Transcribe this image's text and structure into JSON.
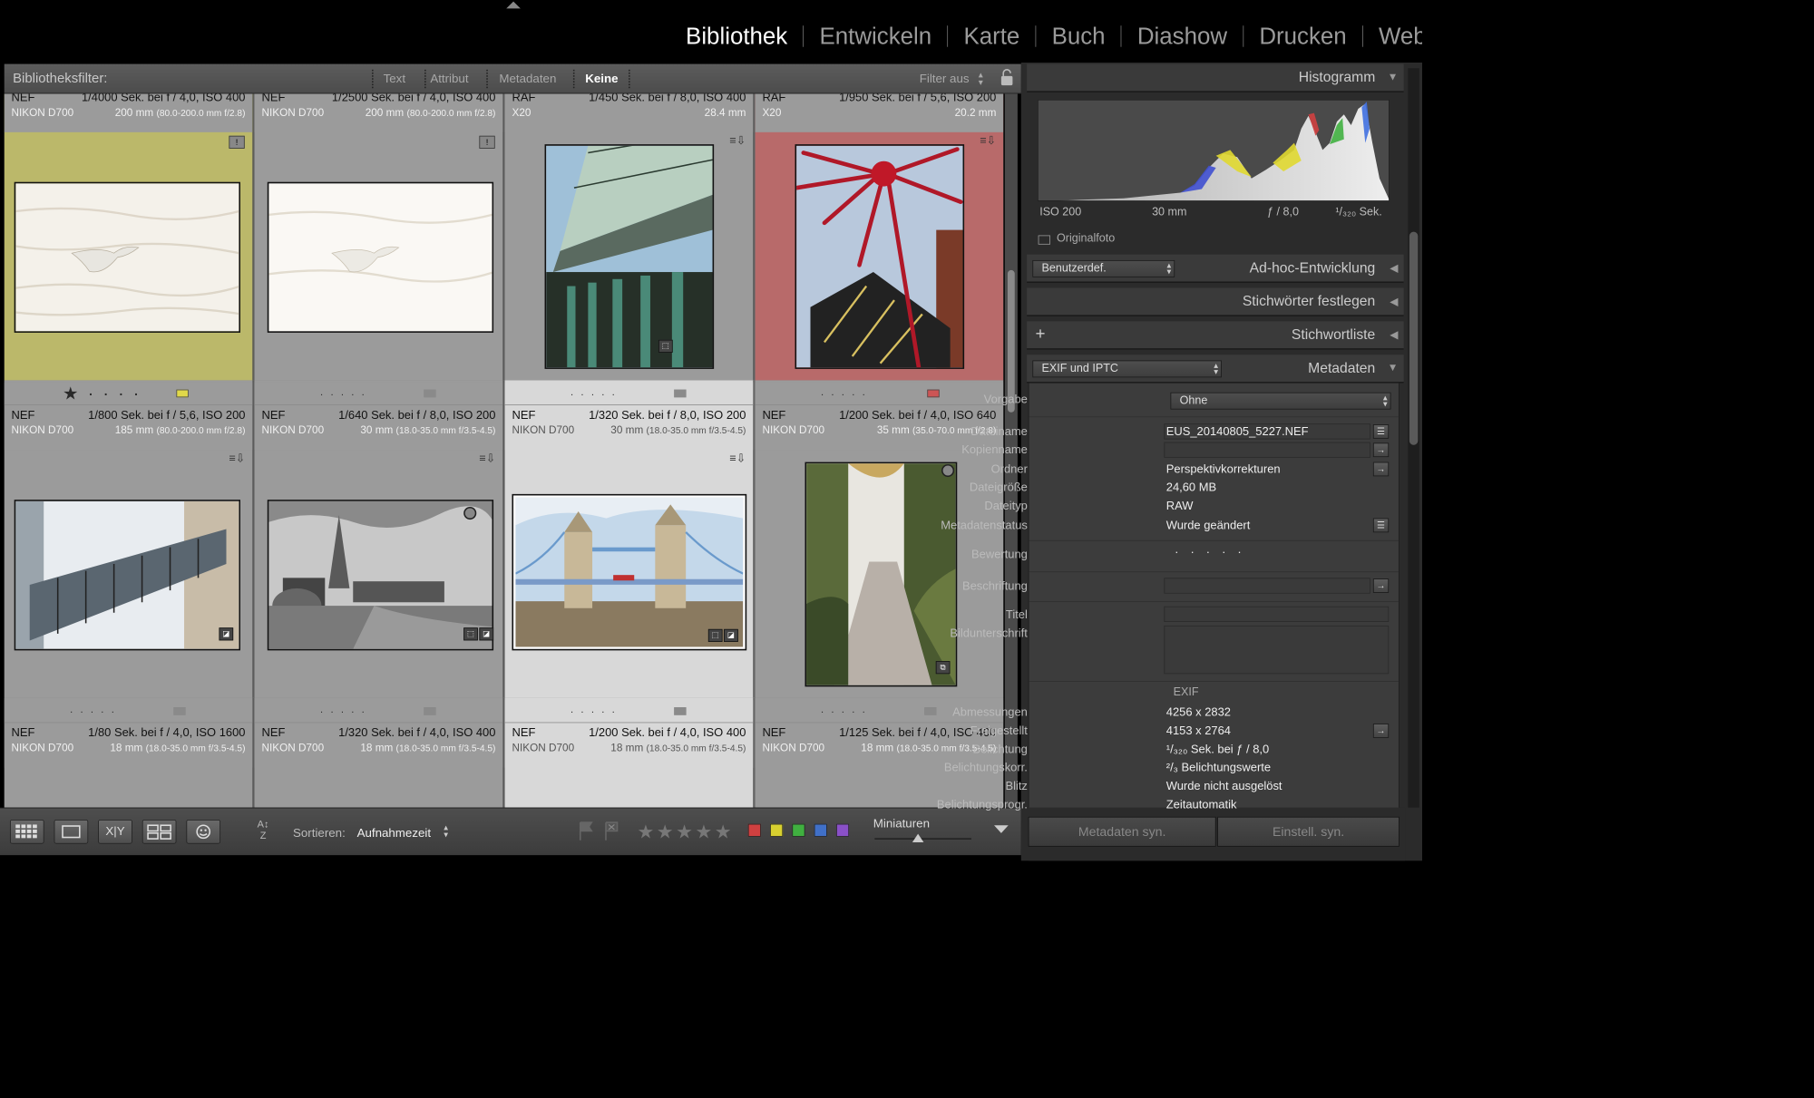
{
  "modules": [
    "Bibliothek",
    "Entwickeln",
    "Karte",
    "Buch",
    "Diashow",
    "Drucken",
    "Web"
  ],
  "filterbar": {
    "label": "Bibliotheksfilter:",
    "tabs": [
      "Text",
      "Attribut",
      "Metadaten",
      "Keine"
    ],
    "active_tab": "Keine",
    "filter_status": "Filter aus"
  },
  "grid": {
    "cells": [
      {
        "stars": "★★★★★",
        "chip": "#8a8a8a",
        "fmt": "NEF",
        "exposure": "1/4000 Sek. bei f / 4,0, ISO 400",
        "camera": "NIKON D700",
        "lens": "200 mm",
        "lens_extra": "(80.0-200.0 mm f/2.8)",
        "bg": "yellow"
      },
      {
        "stars": "★★ · · ·",
        "chip": "#cc5555",
        "fmt": "NEF",
        "exposure": "1/2500 Sek. bei f / 4,0, ISO 400",
        "camera": "NIKON D700",
        "lens": "200 mm",
        "lens_extra": "(80.0-200.0 mm f/2.8)",
        "bg": "none"
      },
      {
        "stars": "· · · · ·",
        "chip": "#cc5555",
        "fmt": "RAF",
        "exposure": "1/450 Sek. bei f / 8,0, ISO 400",
        "camera": "X20",
        "lens": "28.4 mm",
        "lens_extra": "",
        "bg": "none"
      },
      {
        "stars": "· · · · ·",
        "chip": "#cc5555",
        "fmt": "RAF",
        "exposure": "1/950 Sek. bei f / 5,6, ISO 200",
        "camera": "X20",
        "lens": "20.2 mm",
        "lens_extra": "",
        "bg": "red"
      },
      {
        "stars": "★ · · · ·",
        "chip": "#e0d84a",
        "fmt": "NEF",
        "exposure": "1/800 Sek. bei f / 5,6, ISO 200",
        "camera": "NIKON D700",
        "lens": "185 mm",
        "lens_extra": "(80.0-200.0 mm f/2.8)",
        "bg": "none"
      },
      {
        "stars": "· · · · ·",
        "chip": "#8a8a8a",
        "fmt": "NEF",
        "exposure": "1/640 Sek. bei f / 8,0, ISO 200",
        "camera": "NIKON D700",
        "lens": "30 mm",
        "lens_extra": "(18.0-35.0 mm f/3.5-4.5)",
        "bg": "none"
      },
      {
        "stars": "· · · · ·",
        "chip": "#8a8a8a",
        "fmt": "NEF",
        "exposure": "1/320 Sek. bei f / 8,0, ISO 200",
        "camera": "NIKON D700",
        "lens": "30 mm",
        "lens_extra": "(18.0-35.0 mm f/3.5-4.5)",
        "bg": "selected"
      },
      {
        "stars": "· · · · ·",
        "chip": "#cc5555",
        "fmt": "NEF",
        "exposure": "1/200 Sek. bei f / 4,0, ISO 640",
        "camera": "NIKON D700",
        "lens": "35 mm",
        "lens_extra": "(35.0-70.0 mm f/2.8)",
        "bg": "none"
      },
      {
        "stars": "· · · · ·",
        "chip": "#8a8a8a",
        "fmt": "NEF",
        "exposure": "1/80 Sek. bei f / 4,0, ISO 1600",
        "camera": "NIKON D700",
        "lens": "18 mm",
        "lens_extra": "(18.0-35.0 mm f/3.5-4.5)",
        "bg": "none"
      },
      {
        "stars": "· · · · ·",
        "chip": "#8a8a8a",
        "fmt": "NEF",
        "exposure": "1/320 Sek. bei f / 4,0, ISO 400",
        "camera": "NIKON D700",
        "lens": "18 mm",
        "lens_extra": "(18.0-35.0 mm f/3.5-4.5)",
        "bg": "none"
      },
      {
        "stars": "· · · · ·",
        "chip": "#8a8a8a",
        "fmt": "NEF",
        "exposure": "1/200 Sek. bei f / 4,0, ISO 400",
        "camera": "NIKON D700",
        "lens": "18 mm",
        "lens_extra": "(18.0-35.0 mm f/3.5-4.5)",
        "bg": "selected"
      },
      {
        "stars": "· · · · ·",
        "chip": "#8a8a8a",
        "fmt": "NEF",
        "exposure": "1/125 Sek. bei f / 4,0, ISO 400",
        "camera": "NIKON D700",
        "lens": "18 mm",
        "lens_extra": "(18.0-35.0 mm f/3.5-4.5)",
        "bg": "none"
      }
    ]
  },
  "toolbar": {
    "sort_label": "Sortieren:",
    "sort_value": "Aufnahmezeit",
    "stars": "★★★★★",
    "color_labels": [
      "#d04040",
      "#d8d030",
      "#40b040",
      "#4070c8",
      "#8a50c8"
    ],
    "thumb_label": "Miniaturen",
    "thumb_size": 0.45
  },
  "right_panel": {
    "histogram": {
      "title": "Histogramm",
      "iso": "ISO 200",
      "focal": "30 mm",
      "aperture": "ƒ / 8,0",
      "shutter": "¹/₃₂₀ Sek.",
      "original_label": "Originalfoto"
    },
    "quick_develop": {
      "preset": "Benutzerdef.",
      "title": "Ad-hoc-Entwicklung"
    },
    "keywording": {
      "title": "Stichwörter festlegen"
    },
    "keyword_list": {
      "title": "Stichwortliste"
    },
    "metadata": {
      "view": "EXIF und IPTC",
      "title": "Metadaten",
      "preset_label": "Vorgabe",
      "preset_value": "Ohne",
      "rows": [
        {
          "label": "Dateiname",
          "value": "EUS_20140805_5227.NEF"
        },
        {
          "label": "Kopienname",
          "value": ""
        },
        {
          "label": "Ordner",
          "value": "Perspektivkorrekturen"
        },
        {
          "label": "Dateigröße",
          "value": "24,60 MB"
        },
        {
          "label": "Dateityp",
          "value": "RAW"
        },
        {
          "label": "Metadatenstatus",
          "value": "Wurde geändert"
        }
      ],
      "rating_label": "Bewertung",
      "rating_value": "· · · · ·",
      "caption_label": "Beschriftung",
      "title_label": "Titel",
      "description_label": "Bildunterschrift",
      "exif_header": "EXIF",
      "exif_rows": [
        {
          "label": "Abmessungen",
          "value": "4256 x 2832"
        },
        {
          "label": "Freigestellt",
          "value": "4153 x 2764"
        },
        {
          "label": "Belichtung",
          "value": "¹/₃₂₀ Sek. bei ƒ / 8,0"
        },
        {
          "label": "Belichtungskorr.",
          "value": "²/₃ Belichtungswerte"
        },
        {
          "label": "Blitz",
          "value": "Wurde nicht ausgelöst"
        },
        {
          "label": "Belichtungsprogr.",
          "value": "Zeitautomatik"
        }
      ]
    },
    "sync_metadata": "Metadaten syn.",
    "sync_settings": "Einstell. syn."
  }
}
